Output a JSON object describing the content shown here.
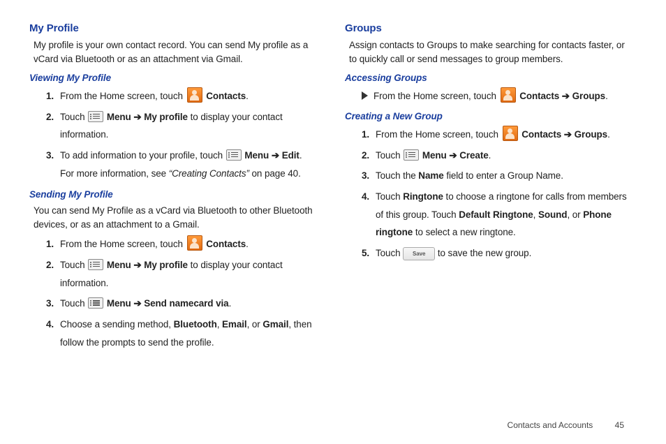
{
  "left": {
    "h1": "My Profile",
    "desc": "My profile is your own contact record. You can send My profile as a vCard via Bluetooth or as an attachment via Gmail.",
    "s1": {
      "title": "Viewing My Profile",
      "i1a": "From the Home screen, touch ",
      "i1b": "Contacts",
      "i2a": "Touch ",
      "i2b": "Menu ➔ My profile",
      "i2c": " to display your contact information.",
      "i3a": "To add information to your profile, touch ",
      "i3b": "Menu ➔ Edit",
      "i3c": ". For more information, see ",
      "i3d": "“Creating Contacts”",
      "i3e": " on page 40."
    },
    "s2": {
      "title": "Sending My Profile",
      "desc": "You can send My Profile as a vCard via Bluetooth to other Bluetooth devices, or as an attachment to a Gmail.",
      "i1a": "From the Home screen, touch ",
      "i1b": "Contacts",
      "i2a": "Touch ",
      "i2b": "Menu ➔ My profile",
      "i2c": " to display your contact information.",
      "i3a": "Touch ",
      "i3b": "Menu ➔ Send namecard via",
      "i4a": "Choose a sending method, ",
      "i4b": "Bluetooth",
      "i4c": "Email",
      "i4d": "Gmail",
      "i4e": ", then follow the prompts to send the profile."
    }
  },
  "right": {
    "h1": "Groups",
    "desc": "Assign contacts to Groups to make searching for contacts faster, or to quickly call or send messages to group members.",
    "s1": {
      "title": "Accessing Groups",
      "i1a": "From the Home screen, touch ",
      "i1b": "Contacts ➔ Groups"
    },
    "s2": {
      "title": "Creating a New Group",
      "i1a": "From the Home screen, touch ",
      "i1b": "Contacts ➔ Groups",
      "i2a": "Touch ",
      "i2b": "Menu ➔ Create",
      "i3a": "Touch the ",
      "i3b": "Name",
      "i3c": " field to enter a Group Name.",
      "i4a": "Touch ",
      "i4b": "Ringtone",
      "i4c": " to choose a ringtone for calls from members of this group. Touch ",
      "i4d": "Default Ringtone",
      "i4e": "Sound",
      "i4f": "Phone ringtone",
      "i4g": " to select a new ringtone.",
      "i5a": "Touch ",
      "i5b": " to save the new group."
    }
  },
  "save_label": "Save",
  "footer": {
    "section": "Contacts and Accounts",
    "page": "45"
  }
}
